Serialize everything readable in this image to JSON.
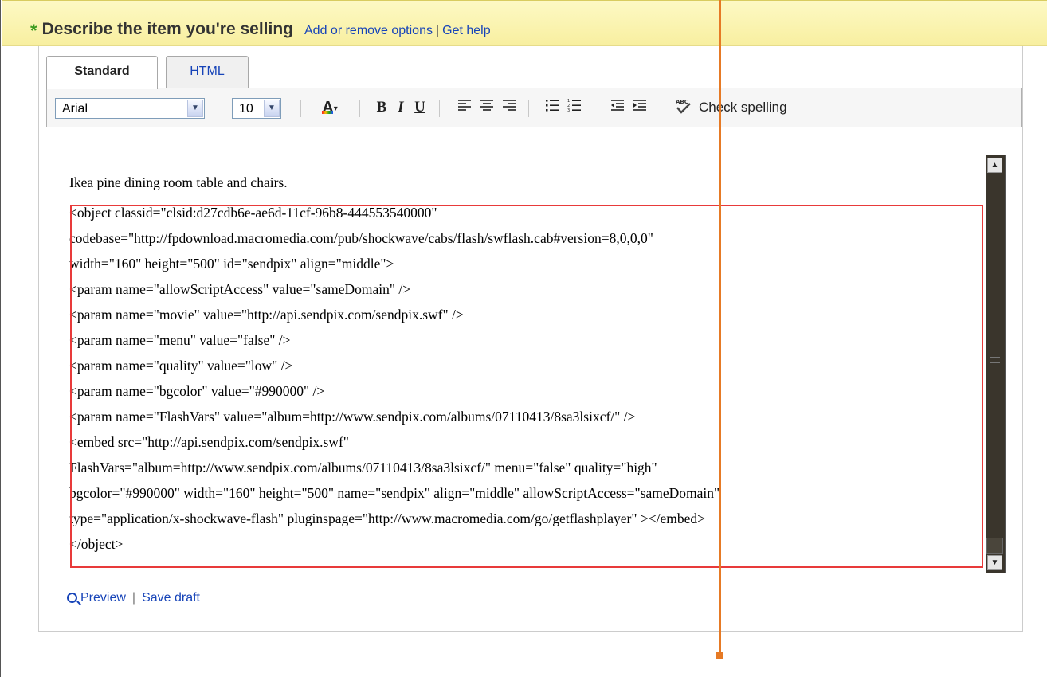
{
  "header": {
    "star": "*",
    "title": "Describe the item you're selling",
    "link_options": "Add or remove options",
    "link_sep": "|",
    "link_help": "Get help"
  },
  "tabs": [
    {
      "label": "Standard",
      "active": true
    },
    {
      "label": "HTML",
      "active": false
    }
  ],
  "toolbar": {
    "font": "Arial",
    "size": "10",
    "bold": "B",
    "italic": "I",
    "underline": "U",
    "check_spelling": "Check spelling"
  },
  "editor": {
    "first_line": "Ikea pine dining room table and chairs.",
    "code_lines": [
      "<object classid=\"clsid:d27cdb6e-ae6d-11cf-96b8-444553540000\"",
      "codebase=\"http://fpdownload.macromedia.com/pub/shockwave/cabs/flash/swflash.cab#version=8,0,0,0\"",
      "width=\"160\" height=\"500\" id=\"sendpix\" align=\"middle\">",
      "<param name=\"allowScriptAccess\" value=\"sameDomain\" />",
      "<param name=\"movie\" value=\"http://api.sendpix.com/sendpix.swf\" />",
      "<param name=\"menu\" value=\"false\" />",
      "<param name=\"quality\" value=\"low\" />",
      "<param name=\"bgcolor\" value=\"#990000\" />",
      "<param name=\"FlashVars\" value=\"album=http://www.sendpix.com/albums/07110413/8sa3lsixcf/\" />",
      "<embed src=\"http://api.sendpix.com/sendpix.swf\"",
      "FlashVars=\"album=http://www.sendpix.com/albums/07110413/8sa3lsixcf/\" menu=\"false\" quality=\"high\"",
      "bgcolor=\"#990000\" width=\"160\" height=\"500\" name=\"sendpix\" align=\"middle\" allowScriptAccess=\"sameDomain\"",
      "type=\"application/x-shockwave-flash\" pluginspage=\"http://www.macromedia.com/go/getflashplayer\" ></embed>",
      "</object>"
    ]
  },
  "footer": {
    "preview": "Preview",
    "sep": "|",
    "save_draft": "Save draft"
  },
  "colors": {
    "accent_star": "#3c9b1f",
    "link": "#1744b8",
    "highlight_box": "#e83a3a",
    "annotation_line": "#e67a25"
  }
}
